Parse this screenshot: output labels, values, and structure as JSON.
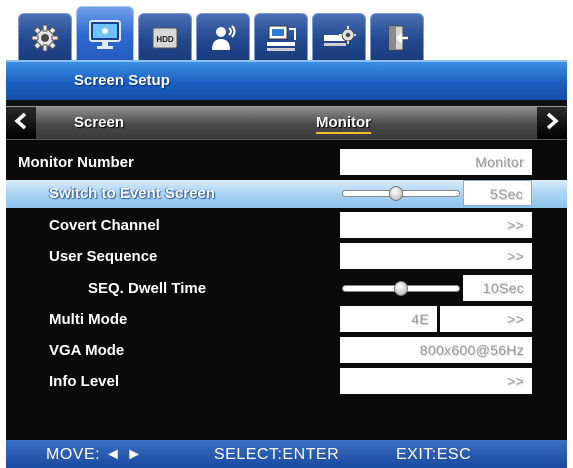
{
  "tabs": [
    {
      "name": "system-settings",
      "icon": "gear-icon",
      "active": false
    },
    {
      "name": "display",
      "icon": "monitor-icon",
      "active": true
    },
    {
      "name": "storage",
      "icon": "hdd-icon",
      "icon_text": "HDD",
      "active": false
    },
    {
      "name": "user",
      "icon": "user-icon",
      "active": false
    },
    {
      "name": "network",
      "icon": "network-icon",
      "active": false
    },
    {
      "name": "device",
      "icon": "device-settings-icon",
      "active": false
    },
    {
      "name": "exit",
      "icon": "exit-door-icon",
      "active": false
    }
  ],
  "panel": {
    "title": "Screen Setup"
  },
  "subnav": {
    "tabs": [
      {
        "label": "Screen",
        "active": false
      },
      {
        "label": "Monitor",
        "active": true
      }
    ]
  },
  "settings": {
    "monitor_number": {
      "label": "Monitor Number",
      "value": "Monitor"
    },
    "switch_event": {
      "label": "Switch to Event Screen",
      "value": "5Sec",
      "level": 0.45
    },
    "covert_channel": {
      "label": "Covert Channel",
      "value": ">>"
    },
    "user_sequence": {
      "label": "User Sequence",
      "value": ">>"
    },
    "seq_dwell": {
      "label": "SEQ. Dwell Time",
      "value": "10Sec",
      "level": 0.5
    },
    "multi_mode": {
      "label": "Multi Mode",
      "value": "4E",
      "action": ">>"
    },
    "vga_mode": {
      "label": "VGA Mode",
      "value": "800x600@56Hz"
    },
    "info_level": {
      "label": "Info Level",
      "value": ">>"
    }
  },
  "footer": {
    "move": "MOVE: ◄ ►",
    "select": "SELECT:ENTER",
    "exit": "EXIT:ESC"
  },
  "colors": {
    "title_blue": "#1a5fc0",
    "highlight": "#a9d3f3",
    "panel_bg": "#0a0a0a",
    "field_text": "#9a9a9a"
  }
}
